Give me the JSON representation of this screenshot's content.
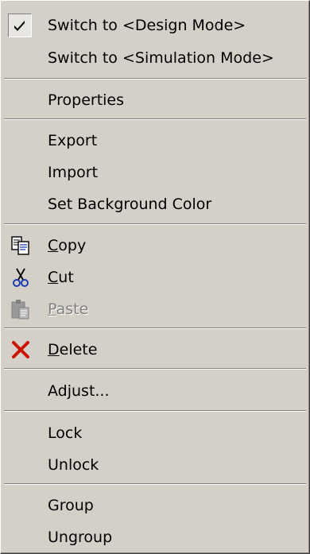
{
  "menu": {
    "items": [
      {
        "label": "Switch to <Design Mode>",
        "checked": true
      },
      {
        "label": "Switch to <Simulation Mode>"
      },
      {
        "label": "Properties"
      },
      {
        "label": "Export"
      },
      {
        "label": "Import"
      },
      {
        "label": "Set Background Color"
      },
      {
        "label": "Copy",
        "icon": "copy-icon"
      },
      {
        "label": "Cut",
        "icon": "cut-icon"
      },
      {
        "label": "Paste",
        "icon": "paste-icon",
        "disabled": true
      },
      {
        "label": "Delete",
        "icon": "delete-icon"
      },
      {
        "label": "Adjust..."
      },
      {
        "label": "Lock"
      },
      {
        "label": "Unlock"
      },
      {
        "label": "Group"
      },
      {
        "label": "Ungroup"
      }
    ]
  },
  "colors": {
    "menu_face": "#d4d0c8",
    "disabled_text": "#808080",
    "delete_icon": "#cc1100"
  }
}
